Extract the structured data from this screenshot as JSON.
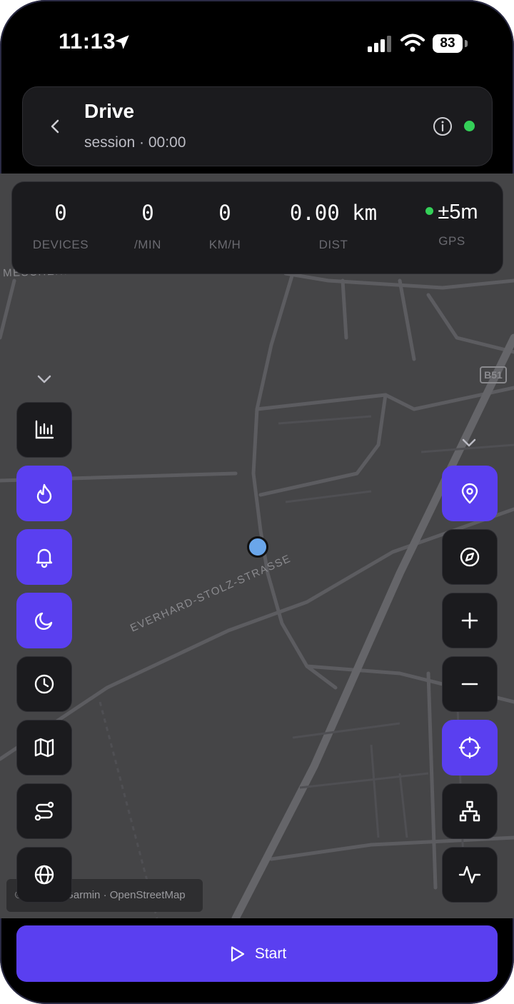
{
  "status_bar": {
    "time": "11:13",
    "battery": "83"
  },
  "header": {
    "title": "Drive",
    "subtitle": "session · 00:00"
  },
  "stats": [
    {
      "value": "0",
      "label": "DEVICES"
    },
    {
      "value": "0",
      "label": "/MIN"
    },
    {
      "value": "0",
      "label": "KM/H"
    },
    {
      "value": "0.00 km",
      "label": "DIST"
    },
    {
      "value": "±5m",
      "label": "GPS"
    }
  ],
  "map": {
    "street_label_1": "MESCHENICHER WEG",
    "street_label_2": "EVERHARD-STOLZ-STRASSE",
    "road_shield": "B51",
    "attribution": "© HERE · Garmin · OpenStreetMap"
  },
  "left_toolbar": [
    {
      "icon": "bar-chart-icon",
      "active": false
    },
    {
      "icon": "flame-icon",
      "active": true
    },
    {
      "icon": "bell-icon",
      "active": true
    },
    {
      "icon": "moon-icon",
      "active": true
    },
    {
      "icon": "clock-icon",
      "active": false
    },
    {
      "icon": "map-icon",
      "active": false
    },
    {
      "icon": "route-icon",
      "active": false
    },
    {
      "icon": "globe-icon",
      "active": false
    }
  ],
  "right_toolbar": [
    {
      "icon": "map-pin-icon",
      "active": true
    },
    {
      "icon": "compass-icon",
      "active": false
    },
    {
      "icon": "plus-icon",
      "active": false
    },
    {
      "icon": "minus-icon",
      "active": false
    },
    {
      "icon": "crosshair-icon",
      "active": true
    },
    {
      "icon": "network-icon",
      "active": false
    },
    {
      "icon": "activity-icon",
      "active": false
    }
  ],
  "start_button": {
    "label": "Start"
  },
  "colors": {
    "accent": "#5a3ff0",
    "live": "#34d058",
    "map_bg": "#454547",
    "card": "#1b1b1e"
  }
}
